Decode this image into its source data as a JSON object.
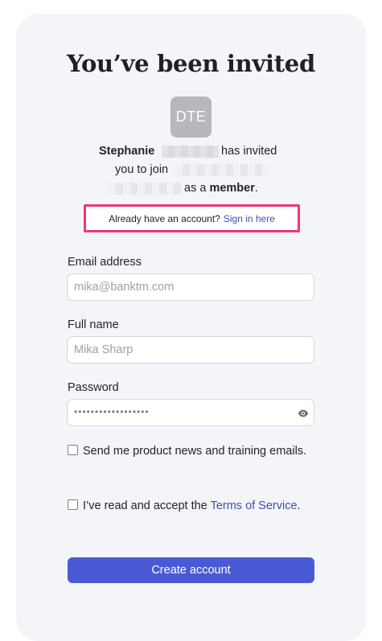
{
  "heading": "You’ve been invited",
  "avatar_initials": "DTE",
  "invite": {
    "inviter_first_name": "Stephanie",
    "has_invited": "has invited",
    "you_to_join": "you to join",
    "as_a": "as a",
    "role": "member",
    "period": "."
  },
  "signin_prompt": {
    "text": "Already have an account?",
    "link": "Sign in here"
  },
  "form": {
    "email": {
      "label": "Email address",
      "placeholder": "mika@banktm.com"
    },
    "full_name": {
      "label": "Full name",
      "placeholder": "Mika Sharp"
    },
    "password": {
      "label": "Password",
      "masked_value": "••••••••••••••••••"
    }
  },
  "checkboxes": {
    "news": {
      "text": "Send me product news and training emails.",
      "checked": false
    },
    "terms": {
      "text_before": "I’ve read and accept the",
      "link": "Terms of Service",
      "text_after": ".",
      "checked": false
    }
  },
  "submit_label": "Create account",
  "colors": {
    "accent": "#4a5ad6",
    "link": "#3c4fb8",
    "highlight_border": "#f0357a",
    "card_background": "#f4f5f9",
    "avatar_background": "#b6b8bd"
  },
  "icons": {
    "password_toggle": "eye-icon"
  }
}
